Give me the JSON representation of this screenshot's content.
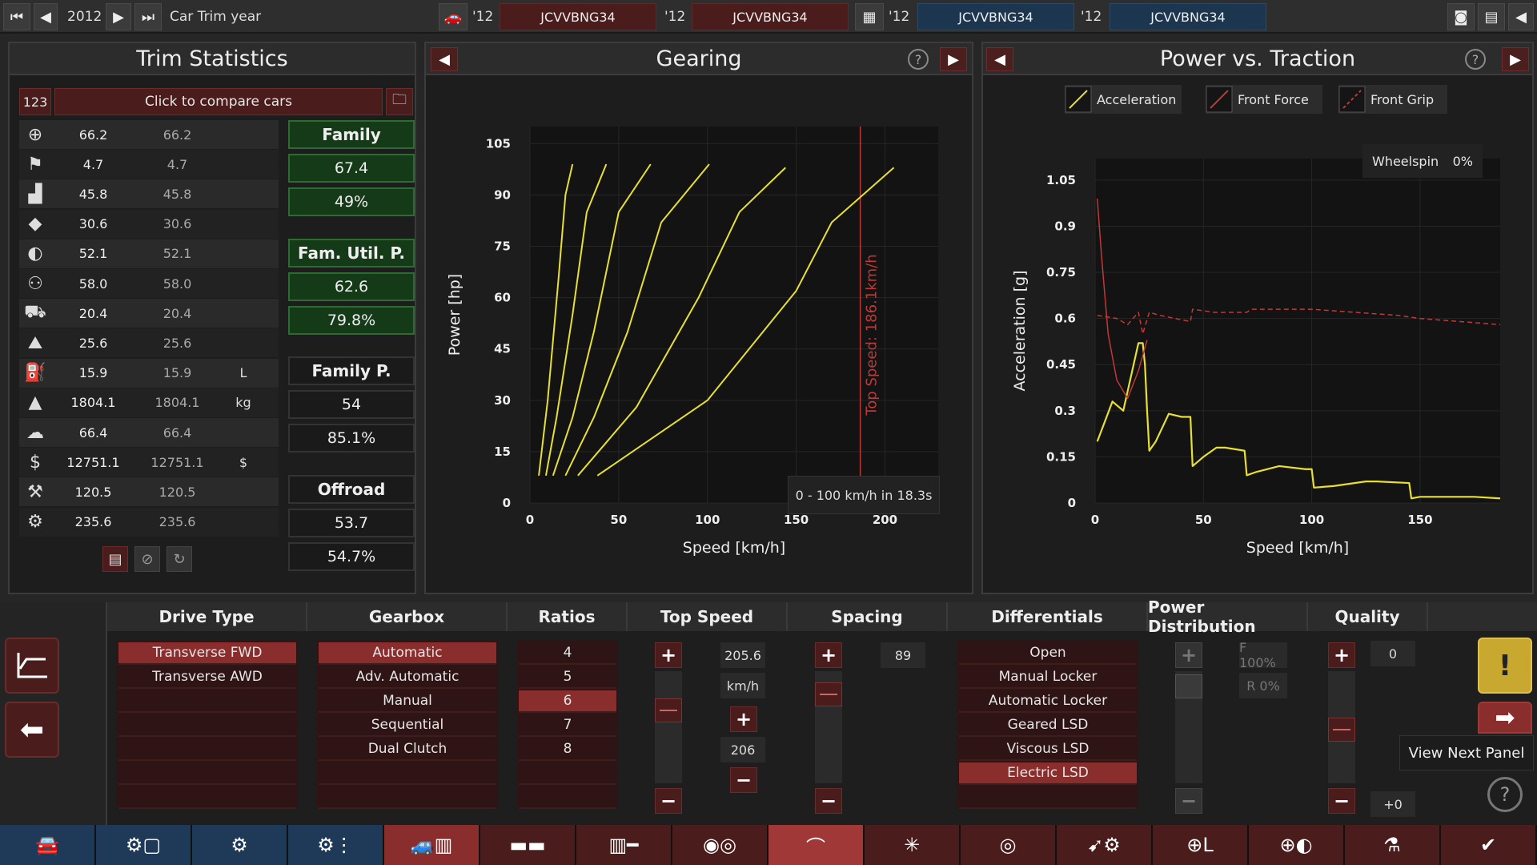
{
  "topbar": {
    "year": "2012",
    "trim_label": "Car Trim year",
    "slots": [
      {
        "year": "'12",
        "name": "JCVVBNG34"
      },
      {
        "year": "'12",
        "name": "JCVVBNG34"
      },
      {
        "year": "'12",
        "name": "JCVVBNG34"
      },
      {
        "year": "'12",
        "name": "JCVVBNG34"
      }
    ]
  },
  "trim": {
    "title": "Trim Statistics",
    "compare_id": "123",
    "compare_label": "Click to compare cars",
    "rows": [
      {
        "icon": "steering-wheel-icon",
        "v1": "66.2",
        "v2": "66.2",
        "unit": ""
      },
      {
        "icon": "race-flag-icon",
        "v1": "4.7",
        "v2": "4.7",
        "unit": ""
      },
      {
        "icon": "seat-icon",
        "v1": "45.8",
        "v2": "45.8",
        "unit": ""
      },
      {
        "icon": "diamond-icon",
        "v1": "30.6",
        "v2": "30.6",
        "unit": ""
      },
      {
        "icon": "safety-icon",
        "v1": "52.1",
        "v2": "52.1",
        "unit": ""
      },
      {
        "icon": "people-icon",
        "v1": "58.0",
        "v2": "58.0",
        "unit": ""
      },
      {
        "icon": "cargo-car-icon",
        "v1": "20.4",
        "v2": "20.4",
        "unit": ""
      },
      {
        "icon": "offroad-icon",
        "v1": "25.6",
        "v2": "25.6",
        "unit": ""
      },
      {
        "icon": "fuel-icon",
        "v1": "15.9",
        "v2": "15.9",
        "unit": "L"
      },
      {
        "icon": "weight-icon",
        "v1": "1804.1",
        "v2": "1804.1",
        "unit": "kg"
      },
      {
        "icon": "emissions-icon",
        "v1": "66.4",
        "v2": "66.4",
        "unit": ""
      },
      {
        "icon": "cost-icon",
        "v1": "12751.1",
        "v2": "12751.1",
        "unit": "$"
      },
      {
        "icon": "service-icon",
        "v1": "120.5",
        "v2": "120.5",
        "unit": ""
      },
      {
        "icon": "engineering-icon",
        "v1": "235.6",
        "v2": "235.6",
        "unit": ""
      }
    ],
    "cards": [
      {
        "title": "Family",
        "value": "67.4",
        "pct": "49%",
        "green": true
      },
      {
        "title": "Fam. Util. P.",
        "value": "62.6",
        "pct": "79.8%",
        "green": true
      },
      {
        "title": "Family P.",
        "value": "54",
        "pct": "85.1%",
        "green": false
      },
      {
        "title": "Offroad",
        "value": "53.7",
        "pct": "54.7%",
        "green": false
      }
    ]
  },
  "gearing": {
    "title": "Gearing",
    "info_box": "0 - 100 km/h in 18.3s",
    "top_speed_label": "Top Speed: 186.1km/h"
  },
  "power": {
    "title": "Power vs. Traction",
    "legend": [
      "Acceleration",
      "Front Force",
      "Front Grip"
    ],
    "wheelspin_label": "Wheelspin",
    "wheelspin_value": "0%"
  },
  "chart_data": [
    {
      "type": "line",
      "xlabel": "Speed [km/h]",
      "ylabel": "Power [hp]",
      "xlim": [
        0,
        230
      ],
      "ylim": [
        0,
        110
      ],
      "xticks": [
        0,
        50,
        100,
        150,
        200
      ],
      "yticks": [
        0,
        15,
        30,
        45,
        60,
        75,
        90,
        105
      ],
      "vline_x": 186.1,
      "series": [
        {
          "x": [
            5,
            10,
            16,
            20,
            24
          ],
          "y": [
            8,
            30,
            65,
            90,
            99
          ]
        },
        {
          "x": [
            9,
            15,
            24,
            32,
            43
          ],
          "y": [
            8,
            25,
            55,
            85,
            99
          ]
        },
        {
          "x": [
            13,
            24,
            36,
            50,
            68
          ],
          "y": [
            8,
            25,
            50,
            85,
            99
          ]
        },
        {
          "x": [
            20,
            36,
            55,
            74,
            101
          ],
          "y": [
            8,
            25,
            50,
            82,
            99
          ]
        },
        {
          "x": [
            27,
            60,
            95,
            118,
            144
          ],
          "y": [
            8,
            28,
            60,
            85,
            98
          ]
        },
        {
          "x": [
            38,
            100,
            150,
            170,
            205
          ],
          "y": [
            8,
            30,
            62,
            82,
            98
          ]
        }
      ]
    },
    {
      "type": "line",
      "xlabel": "Speed [km/h]",
      "ylabel": "Acceleration [g]",
      "xlim": [
        0,
        187
      ],
      "ylim": [
        0,
        1.12
      ],
      "xticks": [
        0,
        50,
        100,
        150
      ],
      "yticks": [
        0,
        0.15,
        0.3,
        0.45,
        0.6,
        0.75,
        0.9,
        1.05
      ],
      "series": [
        {
          "name": "Acceleration",
          "x": [
            1,
            8,
            13,
            20,
            22,
            23,
            24,
            25,
            28,
            34,
            40,
            44,
            45,
            50,
            56,
            60,
            69,
            70,
            74,
            85,
            97,
            100,
            101,
            110,
            125,
            130,
            145,
            146,
            150,
            160,
            175,
            187
          ],
          "y": [
            0.2,
            0.33,
            0.3,
            0.52,
            0.52,
            0.45,
            0.3,
            0.17,
            0.2,
            0.29,
            0.28,
            0.28,
            0.12,
            0.15,
            0.18,
            0.18,
            0.17,
            0.09,
            0.1,
            0.12,
            0.11,
            0.11,
            0.05,
            0.055,
            0.07,
            0.07,
            0.065,
            0.015,
            0.02,
            0.02,
            0.02,
            0.015
          ]
        },
        {
          "name": "Front Force",
          "x": [
            1,
            3,
            6,
            10,
            15,
            20,
            24
          ],
          "y": [
            0.99,
            0.8,
            0.55,
            0.4,
            0.34,
            0.43,
            0.53
          ]
        },
        {
          "name": "Front Grip",
          "x": [
            1,
            10,
            15,
            20,
            22,
            25,
            30,
            37,
            44,
            45,
            55,
            70,
            72,
            100,
            140,
            150,
            187
          ],
          "y": [
            0.61,
            0.6,
            0.58,
            0.62,
            0.55,
            0.62,
            0.61,
            0.6,
            0.59,
            0.63,
            0.62,
            0.62,
            0.63,
            0.63,
            0.61,
            0.6,
            0.58
          ]
        }
      ]
    }
  ],
  "bottom": {
    "drive_type": {
      "header": "Drive Type",
      "options": [
        "Transverse FWD",
        "Transverse AWD"
      ],
      "selected": 0
    },
    "gearbox": {
      "header": "Gearbox",
      "options": [
        "Automatic",
        "Adv. Automatic",
        "Manual",
        "Sequential",
        "Dual Clutch"
      ],
      "selected": 0
    },
    "ratios": {
      "header": "Ratios",
      "options": [
        "4",
        "5",
        "6",
        "7",
        "8"
      ],
      "selected": 2
    },
    "top_speed": {
      "header": "Top Speed",
      "value": "205.6",
      "unit": "km/h",
      "target": "206"
    },
    "spacing": {
      "header": "Spacing",
      "value": "89"
    },
    "differentials": {
      "header": "Differentials",
      "options": [
        "Open",
        "Manual Locker",
        "Automatic Locker",
        "Geared LSD",
        "Viscous LSD",
        "Electric LSD"
      ],
      "selected": 5
    },
    "power_distribution": {
      "header": "Power Distribution",
      "front": "F 100%",
      "rear": "R 0%"
    },
    "quality": {
      "header": "Quality",
      "value": "0",
      "delta": "+0"
    },
    "tooltip": "View Next Panel"
  },
  "nav": {
    "icons": [
      "car-body-icon",
      "engine-family-icon",
      "engine-icon",
      "engine-tune-icon",
      "chassis-icon",
      "suspension-icon",
      "drivetrain-icon",
      "brakes-icon",
      "gearing-icon",
      "wheels-icon",
      "tyre-icon",
      "aero-icon",
      "interior-icon",
      "safety-icon",
      "testing-icon",
      "finish-icon"
    ]
  }
}
